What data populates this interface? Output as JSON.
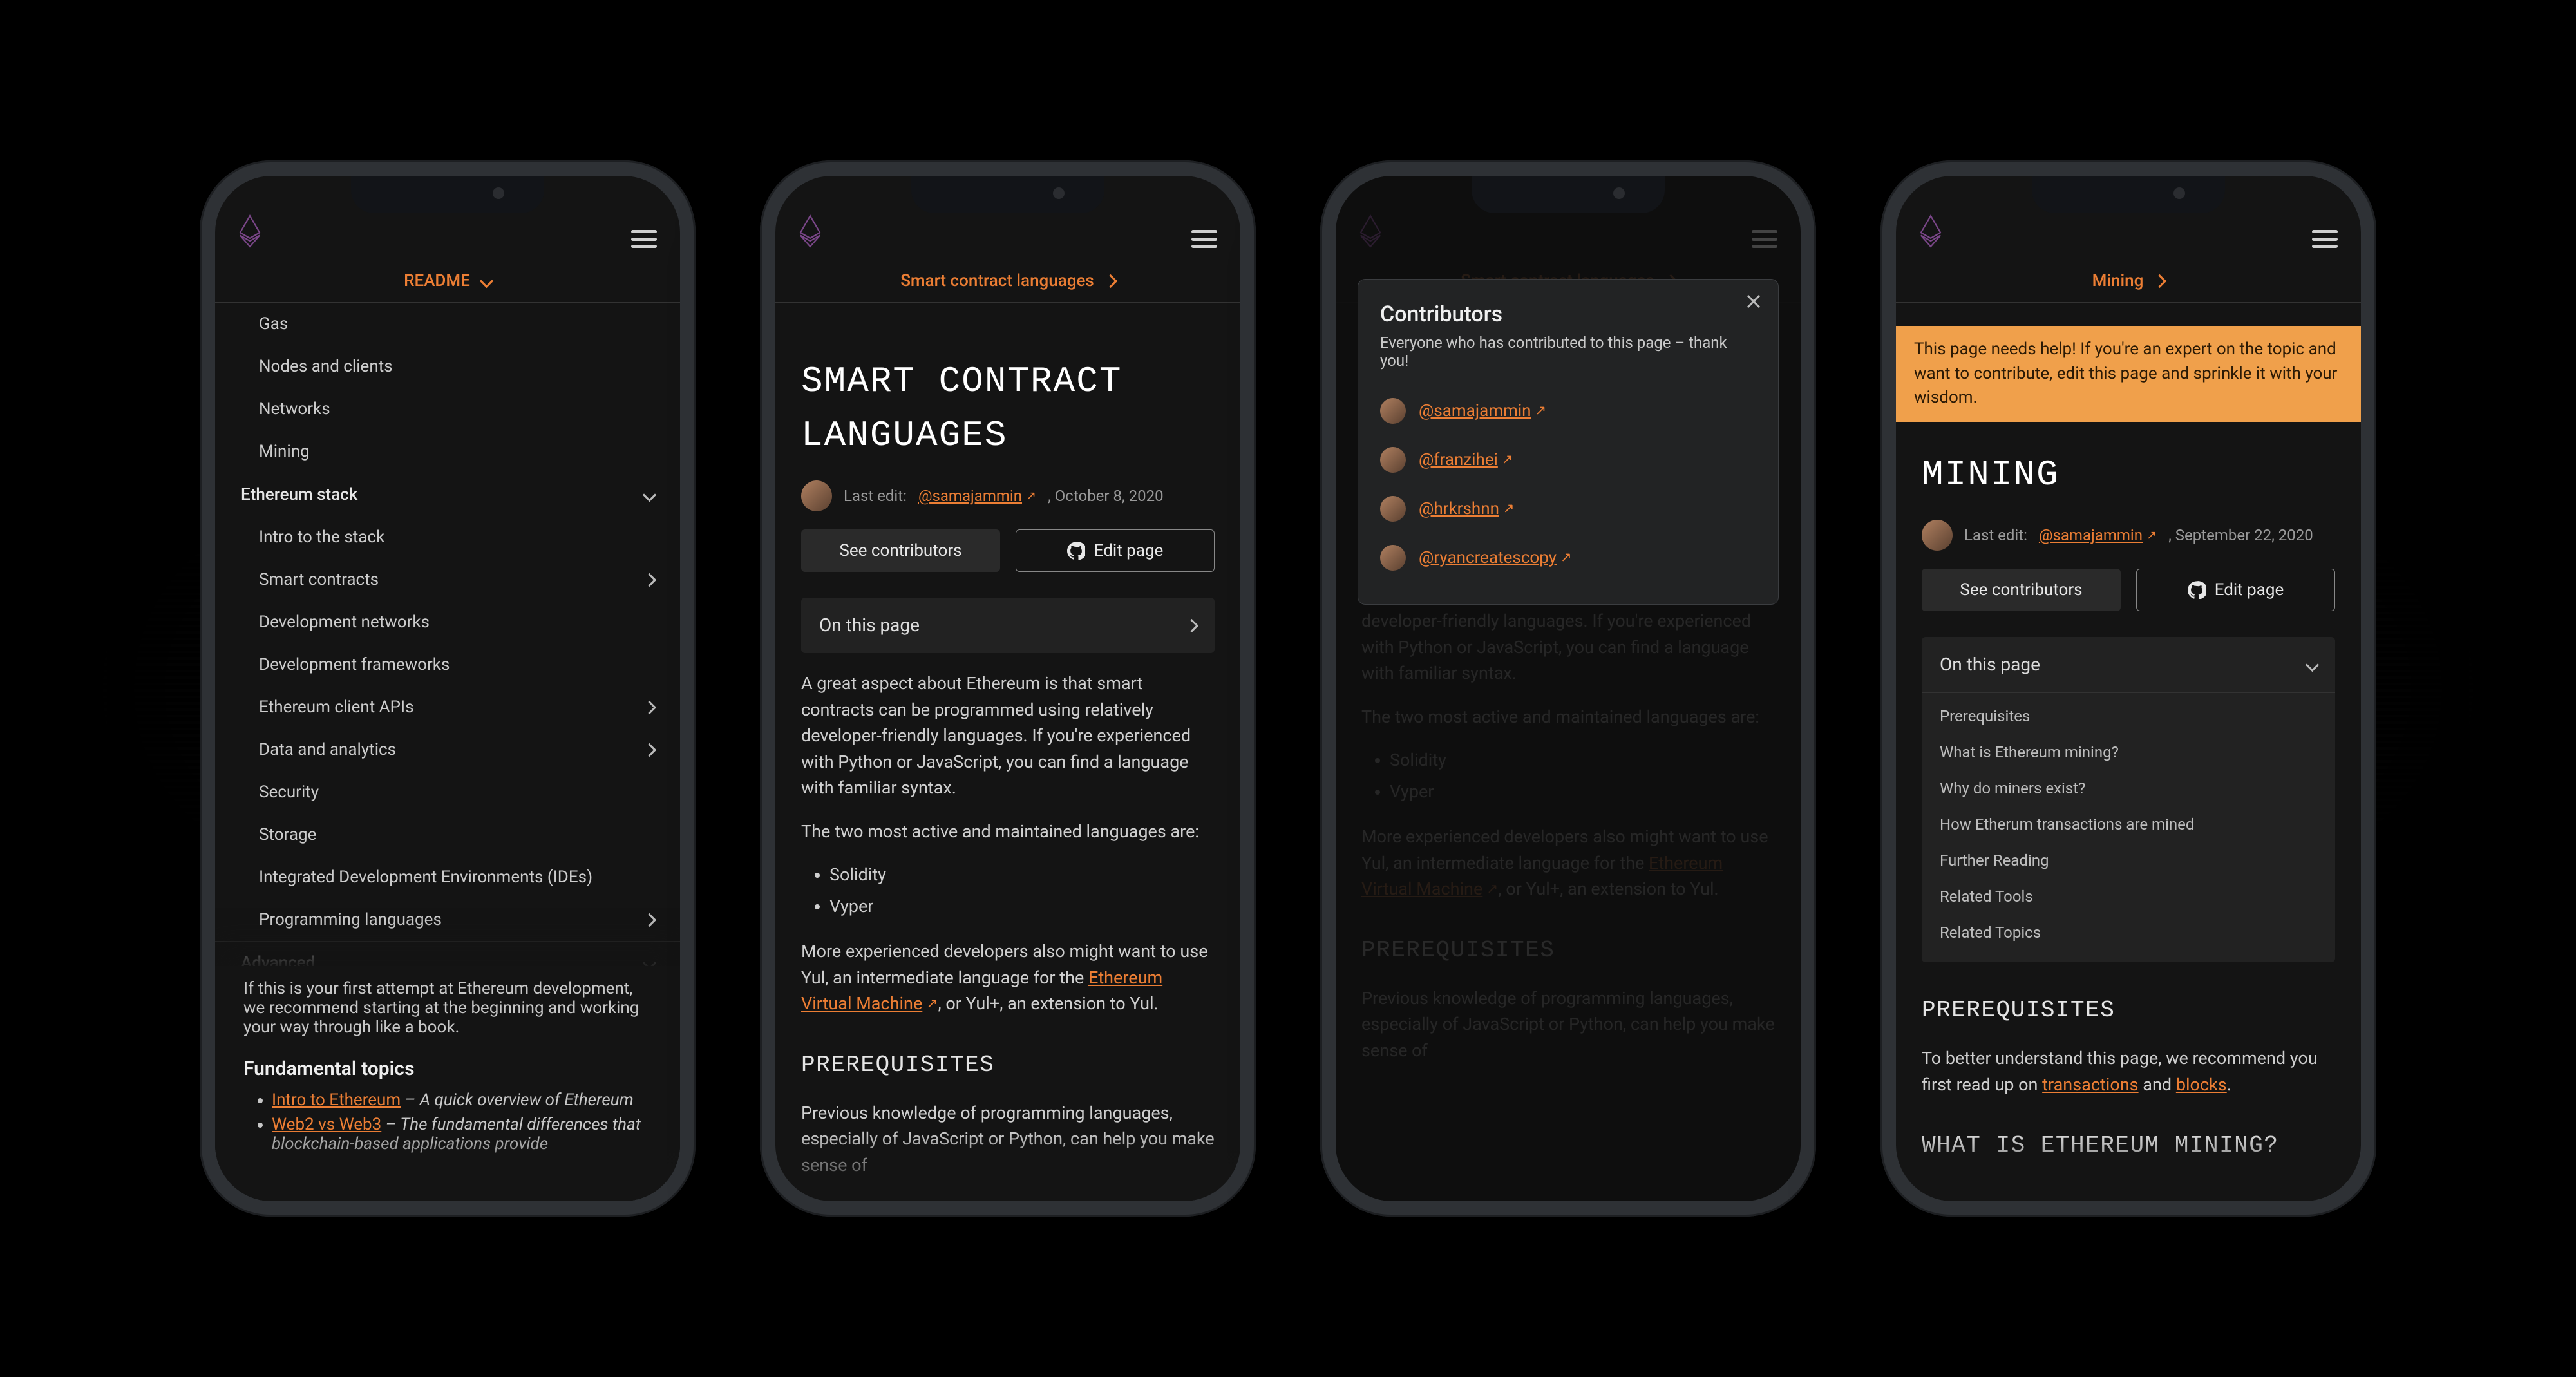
{
  "common": {
    "see_contributors": "See contributors",
    "edit_page": "Edit page",
    "on_this_page": "On this page",
    "last_edit_prefix": "Last edit:"
  },
  "s1": {
    "subheader": "README",
    "nav_items_top": [
      {
        "label": "Gas",
        "level": 1,
        "expand": false
      },
      {
        "label": "Nodes and clients",
        "level": 1,
        "expand": false
      },
      {
        "label": "Networks",
        "level": 1,
        "expand": false
      },
      {
        "label": "Mining",
        "level": 1,
        "expand": false
      }
    ],
    "nav_section": {
      "label": "Ethereum stack",
      "level": 0,
      "expand": true
    },
    "nav_items_mid": [
      {
        "label": "Intro to the stack",
        "level": 1,
        "expand": false
      },
      {
        "label": "Smart contracts",
        "level": 1,
        "expand": true
      },
      {
        "label": "Development networks",
        "level": 1,
        "expand": false
      },
      {
        "label": "Development frameworks",
        "level": 1,
        "expand": false
      },
      {
        "label": "Ethereum client APIs",
        "level": 1,
        "expand": true
      },
      {
        "label": "Data and analytics",
        "level": 1,
        "expand": true
      },
      {
        "label": "Security",
        "level": 1,
        "expand": false
      },
      {
        "label": "Storage",
        "level": 1,
        "expand": false
      },
      {
        "label": "Integrated Development Environments (IDEs)",
        "level": 1,
        "expand": false
      },
      {
        "label": "Programming languages",
        "level": 1,
        "expand": true
      }
    ],
    "nav_section2": {
      "label": "Advanced",
      "level": 0,
      "expand": true
    },
    "below": {
      "para1": "If this is your first attempt at Ethereum development, we recommend starting at the beginning and working your way through like a book.",
      "fund_title": "Fundamental topics",
      "e1_link": "Intro to Ethereum",
      "e1_tail": " – A quick overview of Ethereum",
      "e2_link": "Web2 vs Web3",
      "e2_tail": " – The fundamental differences that blockchain-based applications provide"
    }
  },
  "s2": {
    "subheader": "Smart contract languages",
    "title": "SMART CONTRACT LANGUAGES",
    "editor": "@samajammin",
    "edit_date": ", October 8, 2020",
    "p1": "A great aspect about Ethereum is that smart contracts can be programmed using relatively developer-friendly languages. If you're experienced with Python or JavaScript, you can find a language with familiar syntax.",
    "p2": "The two most active and maintained languages are:",
    "li1": "Solidity",
    "li2": "Vyper",
    "p3a": "More experienced developers also might want to use Yul, an intermediate language for the ",
    "p3link": "Ethereum Virtual Machine",
    "p3b": ", or Yul+, an extension to Yul.",
    "h_prereq": "PREREQUISITES",
    "p4": "Previous knowledge of programming languages, especially of JavaScript or Python, can help you make sense of"
  },
  "s3": {
    "modal_title": "Contributors",
    "modal_sub": "Everyone who has contributed to this page – thank you!",
    "contribs": [
      "@samajammin",
      "@franzihei",
      "@hrkrshnn",
      "@ryancreatescopy"
    ]
  },
  "s4": {
    "subheader": "Mining",
    "banner": "This page needs help! If you're an expert on the topic and want to contribute, edit this page and sprinkle it with your wisdom.",
    "title": "MINING",
    "editor": "@samajammin",
    "edit_date": ", September 22, 2020",
    "toc": [
      "Prerequisites",
      "What is Ethereum mining?",
      "Why do miners exist?",
      "How Etherum transactions are mined",
      "Further Reading",
      "Related Tools",
      "Related Topics"
    ],
    "h_prereq": "PREREQUISITES",
    "p1a": "To better understand this page, we recommend you first read up on ",
    "p1l1": "transactions",
    "p1mid": " and ",
    "p1l2": "blocks",
    "p1b": ".",
    "h_what": "WHAT IS ETHEREUM MINING?"
  }
}
